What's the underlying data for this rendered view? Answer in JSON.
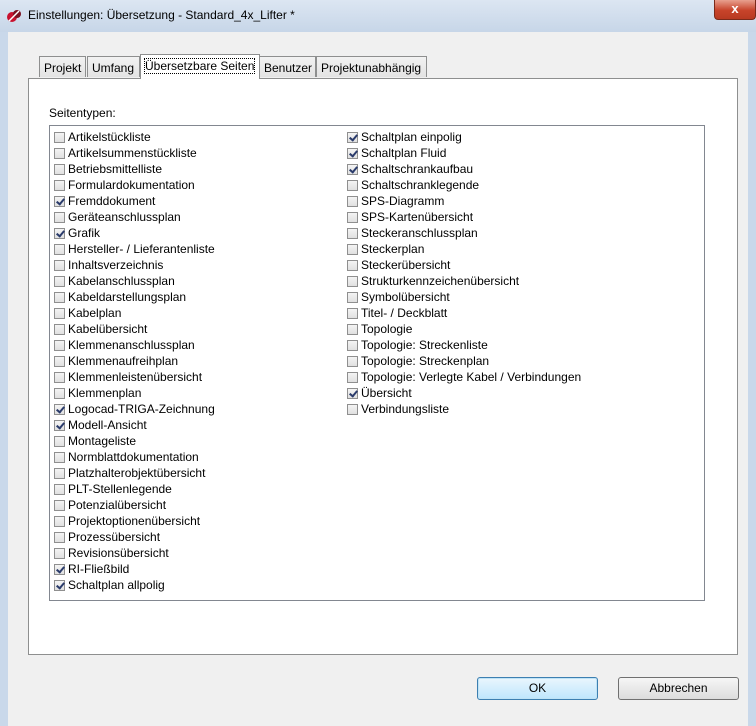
{
  "window": {
    "title": "Einstellungen: Übersetzung - Standard_4x_Lifter *",
    "close_glyph": "x",
    "accent_colors": {
      "close": "#c7432a",
      "frame": "#c9d8ea"
    }
  },
  "tabs": [
    {
      "label": "Projekt",
      "active": false
    },
    {
      "label": "Umfang",
      "active": false
    },
    {
      "label": "Übersetzbare Seiten",
      "active": true
    },
    {
      "label": "Benutzer",
      "active": false
    },
    {
      "label": "Projektunabhängig",
      "active": false
    }
  ],
  "section_label": "Seitentypen:",
  "page_types": [
    {
      "label": "Artikelstückliste",
      "checked": false
    },
    {
      "label": "Artikelsummenstückliste",
      "checked": false
    },
    {
      "label": "Betriebsmittelliste",
      "checked": false
    },
    {
      "label": "Formulardokumentation",
      "checked": false
    },
    {
      "label": "Fremddokument",
      "checked": true
    },
    {
      "label": "Geräteanschlussplan",
      "checked": false
    },
    {
      "label": "Grafik",
      "checked": true
    },
    {
      "label": "Hersteller- / Lieferantenliste",
      "checked": false
    },
    {
      "label": "Inhaltsverzeichnis",
      "checked": false
    },
    {
      "label": "Kabelanschlussplan",
      "checked": false
    },
    {
      "label": "Kabeldarstellungsplan",
      "checked": false
    },
    {
      "label": "Kabelplan",
      "checked": false
    },
    {
      "label": "Kabelübersicht",
      "checked": false
    },
    {
      "label": "Klemmenanschlussplan",
      "checked": false
    },
    {
      "label": "Klemmenaufreihplan",
      "checked": false
    },
    {
      "label": "Klemmenleistenübersicht",
      "checked": false
    },
    {
      "label": "Klemmenplan",
      "checked": false
    },
    {
      "label": "Logocad-TRIGA-Zeichnung",
      "checked": true
    },
    {
      "label": "Modell-Ansicht",
      "checked": true
    },
    {
      "label": "Montageliste",
      "checked": false
    },
    {
      "label": "Normblattdokumentation",
      "checked": false
    },
    {
      "label": "Platzhalterobjektübersicht",
      "checked": false
    },
    {
      "label": "PLT-Stellenlegende",
      "checked": false
    },
    {
      "label": "Potenzialübersicht",
      "checked": false
    },
    {
      "label": "Projektoptionenübersicht",
      "checked": false
    },
    {
      "label": "Prozessübersicht",
      "checked": false
    },
    {
      "label": "Revisionsübersicht",
      "checked": false
    },
    {
      "label": "RI-Fließbild",
      "checked": true
    },
    {
      "label": "Schaltplan allpolig",
      "checked": true
    },
    {
      "label": "Schaltplan einpolig",
      "checked": true
    },
    {
      "label": "Schaltplan Fluid",
      "checked": true
    },
    {
      "label": "Schaltschrankaufbau",
      "checked": true
    },
    {
      "label": "Schaltschranklegende",
      "checked": false
    },
    {
      "label": "SPS-Diagramm",
      "checked": false
    },
    {
      "label": "SPS-Kartenübersicht",
      "checked": false
    },
    {
      "label": "Steckeranschlussplan",
      "checked": false
    },
    {
      "label": "Steckerplan",
      "checked": false
    },
    {
      "label": "Steckerübersicht",
      "checked": false
    },
    {
      "label": "Strukturkennzeichenübersicht",
      "checked": false
    },
    {
      "label": "Symbolübersicht",
      "checked": false
    },
    {
      "label": "Titel- / Deckblatt",
      "checked": false
    },
    {
      "label": "Topologie",
      "checked": false
    },
    {
      "label": "Topologie: Streckenliste",
      "checked": false
    },
    {
      "label": "Topologie: Streckenplan",
      "checked": false
    },
    {
      "label": "Topologie: Verlegte Kabel / Verbindungen",
      "checked": false
    },
    {
      "label": "Übersicht",
      "checked": true
    },
    {
      "label": "Verbindungsliste",
      "checked": false
    }
  ],
  "buttons": {
    "ok": "OK",
    "cancel": "Abbrechen"
  }
}
